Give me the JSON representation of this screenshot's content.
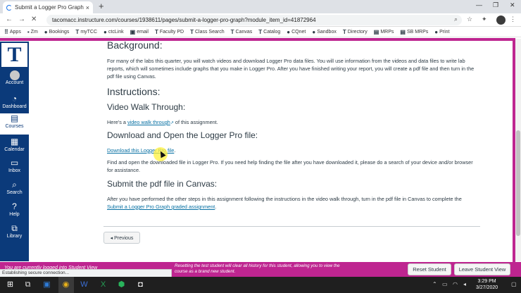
{
  "browser": {
    "tab_title": "Submit a Logger Pro Graph: Phy",
    "tab_close": "×",
    "new_tab": "+",
    "url": "tacomacc.instructure.com/courses/1938611/pages/submit-a-logger-pro-graph?module_item_id=41872964",
    "bookmarks": [
      "Apps",
      "Zm",
      "Bookings",
      "myTCC",
      "ctcLink",
      "email",
      "Faculty PD",
      "Class Search",
      "Canvas",
      "Catalog",
      "CQnet",
      "Sandbox",
      "Directory",
      "MRPs",
      "SB MRPs",
      "Print"
    ]
  },
  "global_nav": {
    "logo": "T",
    "items": [
      {
        "label": "Account",
        "icon": "avatar-icon"
      },
      {
        "label": "Dashboard",
        "icon": "dashboard-icon"
      },
      {
        "label": "Courses",
        "icon": "courses-icon"
      },
      {
        "label": "Calendar",
        "icon": "calendar-icon"
      },
      {
        "label": "Inbox",
        "icon": "inbox-icon"
      },
      {
        "label": "Search",
        "icon": "search-icon"
      },
      {
        "label": "Help",
        "icon": "help-icon"
      },
      {
        "label": "Library",
        "icon": "library-icon"
      }
    ]
  },
  "page": {
    "background_heading": "Background:",
    "background_text": "For many of the labs this quarter, you will watch videos and download Logger Pro data files.  You will use information from the videos and data files to write lab reports, which will sometimes include graphs that you make in Logger Pro.  After you have finished writing your report, you will create a pdf file and then turn in the pdf file using Canvas.",
    "instructions_heading": "Instructions:",
    "video_heading": "Video Walk Through:",
    "video_text_pre": "Here's a ",
    "video_link": "video walk through",
    "video_text_post": " of this assignment.",
    "download_heading": "Download and Open the Logger Pro file:",
    "download_link": "Download this Logger Pro file",
    "download_text_post": ".",
    "find_text": "Find and open the downloaded file in Logger Pro.  If you need help finding the file after you have downloaded it, please do a search of your device and/or browser for assistance.",
    "submit_heading": "Submit the pdf file in Canvas:",
    "submit_text_pre": "After you have performed the other steps in this assignment following the instructions in the video walk through, turn in the pdf file in Canvas to complete the ",
    "submit_link": "Submit a Logger Pro Graph graded assignment",
    "submit_text_post": ".",
    "previous_button": "◂ Previous"
  },
  "student_view": {
    "status_left": "You are currently logged into Student View",
    "message": "Resetting the test student will clear all history for this student, allowing you to view the course as a brand new student.",
    "reset_button": "Reset Student",
    "leave_button": "Leave Student View"
  },
  "status_bar": {
    "text": "Establishing secure connection..."
  },
  "taskbar": {
    "time": "3:29 PM",
    "date": "3/27/2020"
  },
  "colors": {
    "canvas_nav": "#0b3a7a",
    "student_view": "#be2590",
    "link": "#0770a3"
  }
}
